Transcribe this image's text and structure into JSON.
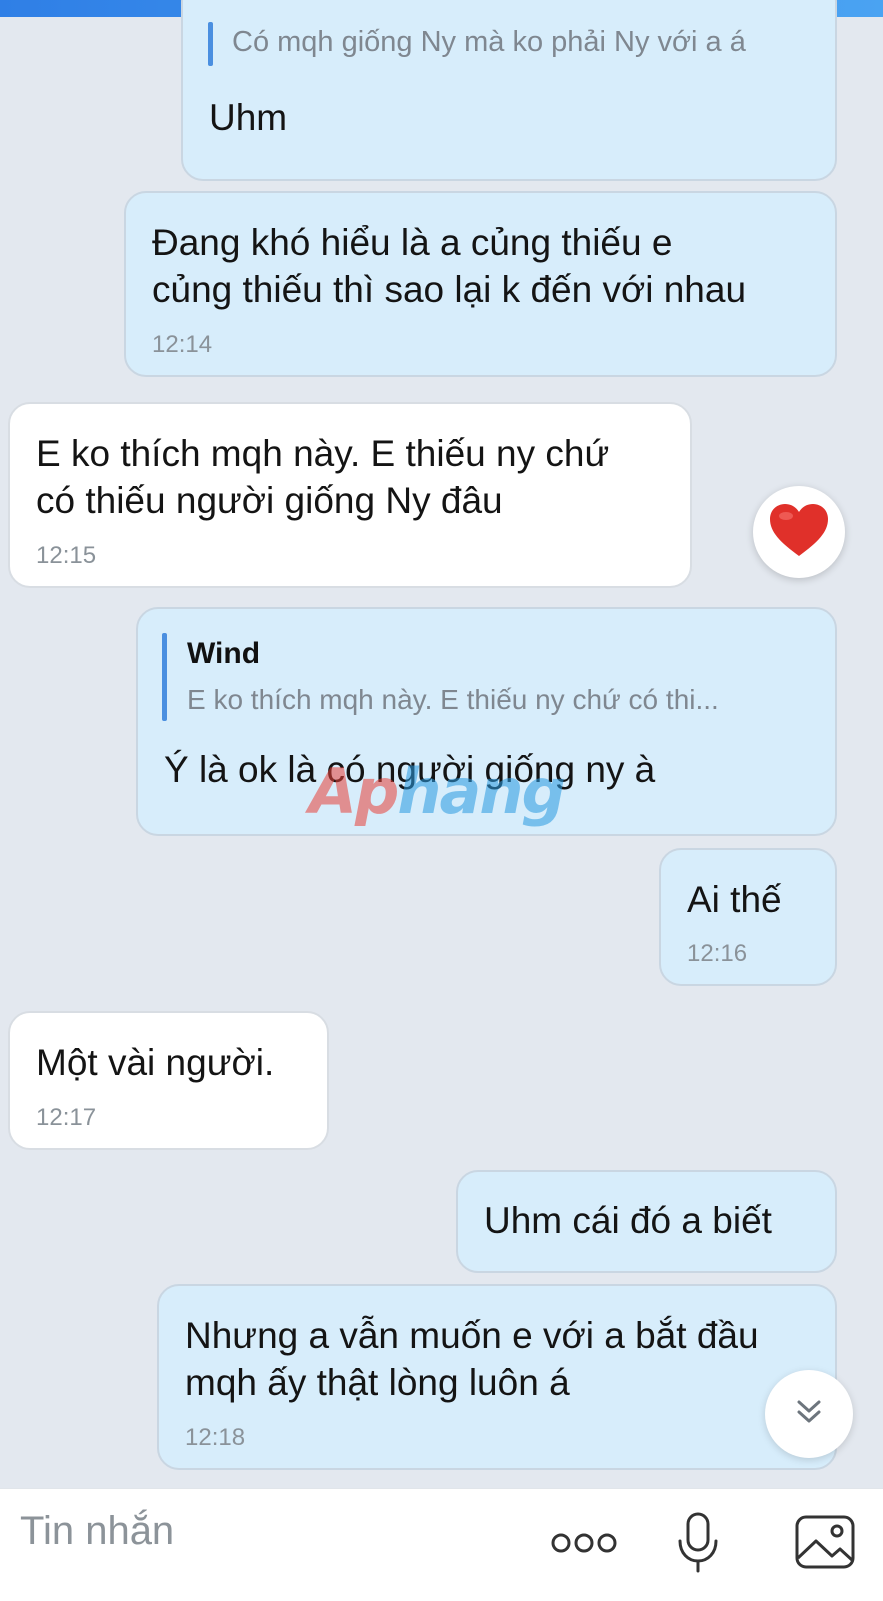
{
  "messages": [
    {
      "id": "m1",
      "direction": "sent",
      "quote_text": "Có mqh giống Ny mà ko phải Ny với a á",
      "lines": [
        "Uhm"
      ]
    },
    {
      "id": "m2",
      "direction": "sent",
      "lines": [
        "Đang khó hiểu là a củng thiếu e",
        "củng thiếu thì sao lại k đến với nhau"
      ],
      "time": "12:14"
    },
    {
      "id": "m3",
      "direction": "received",
      "lines": [
        "E ko thích mqh này. E thiếu ny chứ",
        "có thiếu người giống Ny đâu"
      ],
      "time": "12:15",
      "reaction": "heart"
    },
    {
      "id": "m4",
      "direction": "sent",
      "quote_name": "Wind",
      "quote_text": "E ko thích mqh này. E thiếu ny chứ có thi...",
      "lines": [
        "Ý là ok là có người giống ny à"
      ]
    },
    {
      "id": "m5",
      "direction": "sent",
      "lines": [
        "Ai thế"
      ],
      "time": "12:16"
    },
    {
      "id": "m6",
      "direction": "received",
      "lines": [
        "Một vài người."
      ],
      "time": "12:17"
    },
    {
      "id": "m7",
      "direction": "sent",
      "lines": [
        "Uhm cái đó a biết"
      ]
    },
    {
      "id": "m8",
      "direction": "sent",
      "lines": [
        "Nhưng a vẫn muốn e với a bắt đầu",
        "mqh ấy thật lòng luôn á"
      ],
      "time": "12:18"
    }
  ],
  "watermark": {
    "head": "Ap",
    "tail": "hang"
  },
  "composer": {
    "placeholder": "Tin nhắn"
  },
  "icons": {
    "reaction": "heart-icon",
    "scroll": "chevron-double-down-icon",
    "more": "more-dots-icon",
    "mic": "microphone-icon",
    "image": "image-icon"
  },
  "colors": {
    "background": "#e3e8ef",
    "sent_bubble": "#d7edfb",
    "received_bubble": "#ffffff",
    "quote_bar": "#4a8fe0",
    "heart": "#e0302a",
    "top_bar": "#2f7fe6"
  }
}
